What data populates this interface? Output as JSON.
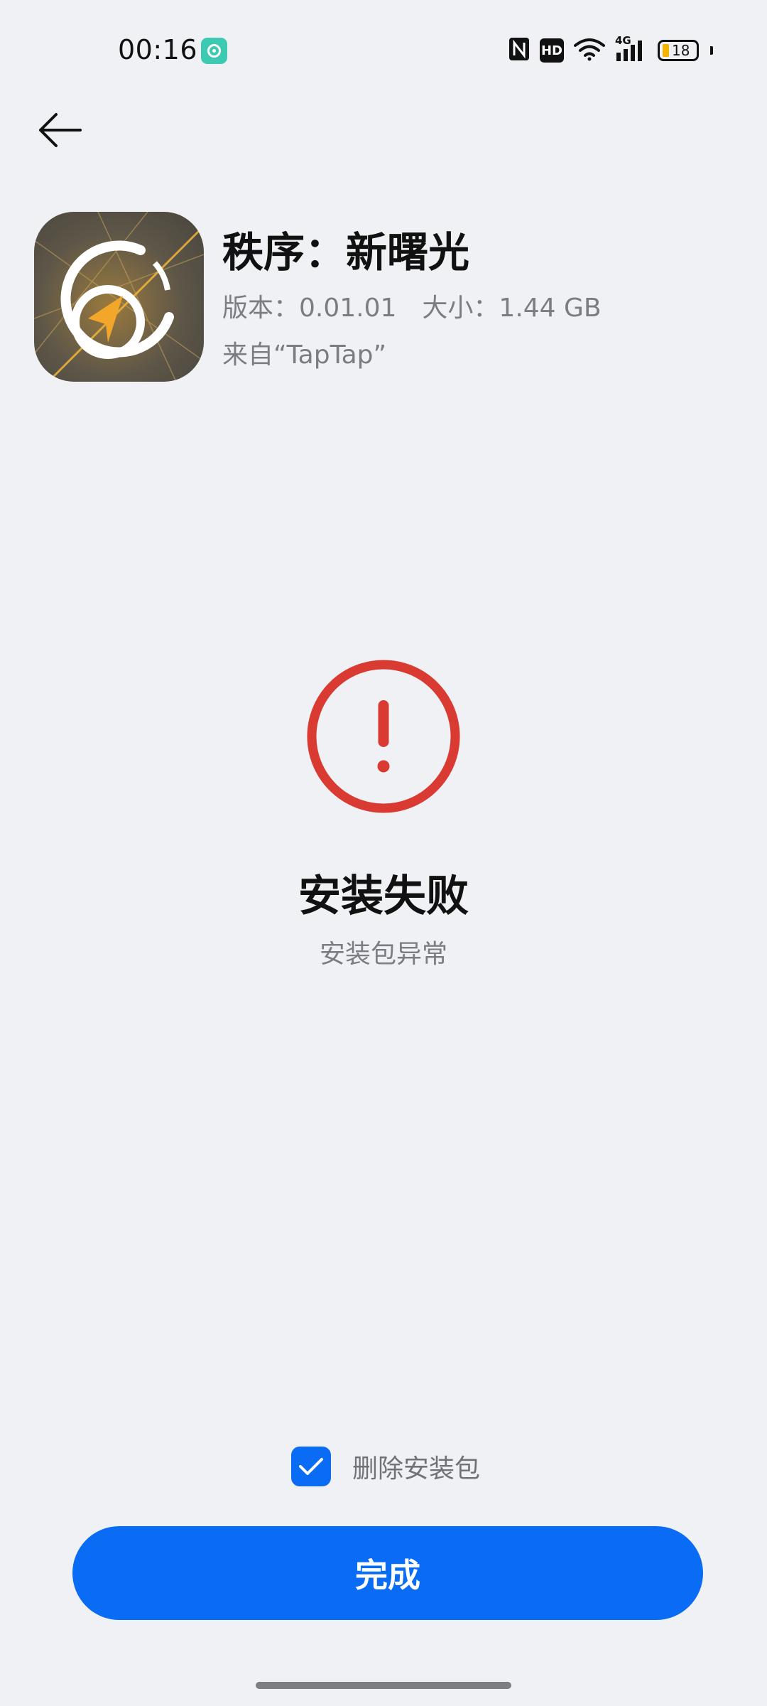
{
  "status_bar": {
    "time": "00:16",
    "hd_label": "HD",
    "network_label": "4G",
    "battery_level": "18",
    "colors": {
      "app_notification": "#3ec9b3",
      "battery_fill": "#f5b400"
    },
    "icons": [
      "nfc-icon",
      "hd-icon",
      "wifi-icon",
      "signal-4g-icon",
      "battery-icon"
    ]
  },
  "header": {
    "back_icon": "arrow-left-icon"
  },
  "app": {
    "name": "秩序：新曙光",
    "version": "版本：0.01.01",
    "size": "大小：1.44 GB",
    "source": "来自“TapTap”",
    "icon": "app-compass-icon"
  },
  "result": {
    "icon": "error-exclamation-icon",
    "title": "安装失败",
    "reason": "安装包异常",
    "color": "#d93a31"
  },
  "options": {
    "delete_package_label": "删除安装包",
    "delete_package_checked": true
  },
  "actions": {
    "done_label": "完成",
    "accent_color": "#0a6cf5"
  }
}
